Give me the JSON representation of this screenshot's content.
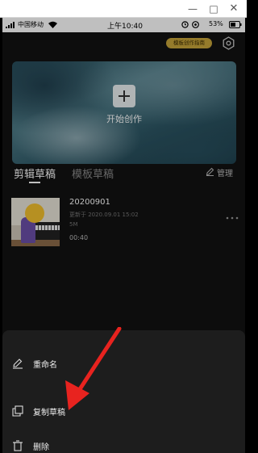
{
  "status_bar": {
    "carrier": "中国移动",
    "time": "上午10:40",
    "battery": "53%"
  },
  "header": {
    "guide_badge": "模板创作指南"
  },
  "banner": {
    "start_label": "开始创作"
  },
  "tabs": [
    {
      "label": "剪辑草稿",
      "active": true
    },
    {
      "label": "模板草稿",
      "active": false
    }
  ],
  "manage_label": "管理",
  "draft": {
    "title": "20200901",
    "updated": "更新于 2020.09.01 15:02",
    "size": "5M",
    "duration": "00:40"
  },
  "bottom_sheet": {
    "items": [
      {
        "label": "重命名",
        "icon": "pencil-icon"
      },
      {
        "label": "复制草稿",
        "icon": "copy-icon"
      },
      {
        "label": "删除",
        "icon": "trash-icon"
      }
    ]
  },
  "colors": {
    "background": "#121212",
    "sheet": "#1d1d1d",
    "badge": "#c7a43a",
    "annotation_arrow": "#e8231f"
  }
}
